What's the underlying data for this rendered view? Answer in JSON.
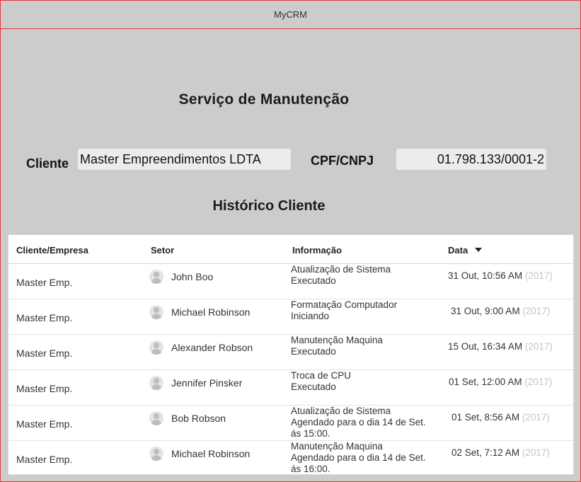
{
  "window": {
    "title": "MyCRM"
  },
  "page": {
    "title": "Serviço de Manutenção"
  },
  "form": {
    "cliente_label": "Cliente",
    "cliente_value": "Master Empreendimentos LDTA",
    "cnpj_label": "CPF/CNPJ",
    "cnpj_value": "01.798.133/0001-2"
  },
  "history": {
    "title": "Histórico Cliente",
    "columns": [
      "Cliente/Empresa",
      "Setor",
      "Informação",
      "Data"
    ],
    "sorted_column": "Data",
    "rows": [
      {
        "cliente": "Master Emp.",
        "setor": "John Boo",
        "info_line1": "Atualização de Sistema",
        "info_line2": "Executado",
        "info_line3": "",
        "date": "31 Out, 10:56 AM",
        "year": "(2017)"
      },
      {
        "cliente": "Master Emp.",
        "setor": "Michael Robinson",
        "info_line1": "Formatação Computador",
        "info_line2": "Iniciando",
        "info_line3": "",
        "date": "31 Out, 9:00 AM",
        "year": "(2017)"
      },
      {
        "cliente": "Master Emp.",
        "setor": "Alexander Robson",
        "info_line1": "Manutenção Maquina",
        "info_line2": "Executado",
        "info_line3": "",
        "date": "15 Out, 16:34 AM",
        "year": "(2017)"
      },
      {
        "cliente": "Master Emp.",
        "setor": "Jennifer Pinsker",
        "info_line1": "Troca de CPU",
        "info_line2": "Executado",
        "info_line3": "",
        "date": "01 Set, 12:00 AM",
        "year": "(2017)"
      },
      {
        "cliente": "Master Emp.",
        "setor": "Bob Robson",
        "info_line1": "Atualização de Sistema",
        "info_line2": "Agendado para o dia 14 de Set.",
        "info_line3": "ás 15:00.",
        "date": "01 Set, 8:56 AM",
        "year": "(2017)"
      },
      {
        "cliente": "Master Emp.",
        "setor": "Michael Robinson",
        "info_line1": "Manutenção Maquina",
        "info_line2": "Agendado para o dia 14 de Set.",
        "info_line3": "ás 16:00.",
        "date": "02 Set, 7:12 AM",
        "year": "(2017)"
      }
    ]
  }
}
